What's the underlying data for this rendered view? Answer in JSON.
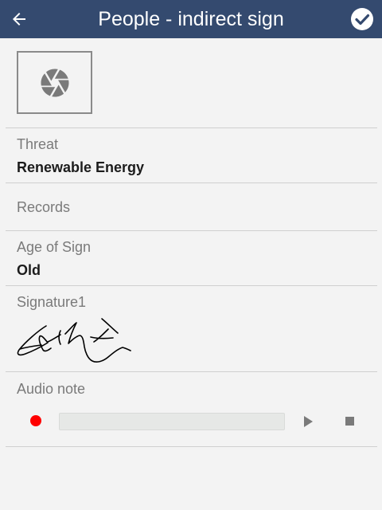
{
  "header": {
    "title": "People - indirect sign",
    "background_color": "#344a6f"
  },
  "icons": {
    "back": "arrow-left-icon",
    "confirm": "check-circle-icon",
    "photo": "camera-shutter-icon",
    "record": "record-icon",
    "play": "play-icon",
    "stop": "stop-icon"
  },
  "fields": {
    "threat": {
      "label": "Threat",
      "value": "Renewable Energy"
    },
    "records": {
      "label": "Records"
    },
    "age": {
      "label": "Age of Sign",
      "value": "Old"
    },
    "signature": {
      "label": "Signature1"
    },
    "audio": {
      "label": "Audio note",
      "progress": 0,
      "record_color": "#ff0000"
    }
  }
}
